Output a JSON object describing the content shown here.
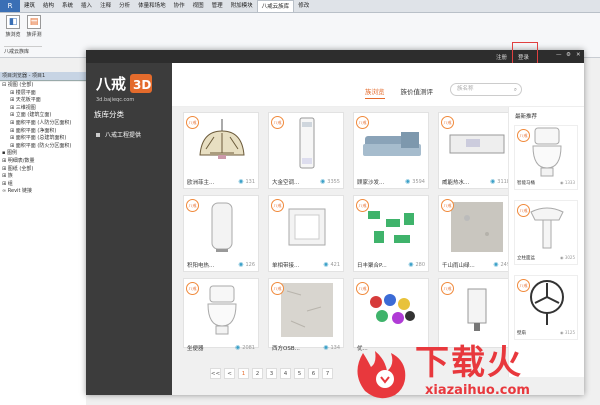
{
  "ribbon": {
    "tabs": [
      "建筑",
      "结构",
      "系统",
      "插入",
      "注释",
      "分析",
      "体量和场地",
      "协作",
      "视图",
      "管理",
      "附加模块",
      "八戒云族库",
      "修改"
    ],
    "active_tab": "八戒云族库",
    "buttons": [
      {
        "label": "族浏览"
      },
      {
        "label": "族评测"
      }
    ],
    "panel_label": "八戒云族库"
  },
  "project_browser": {
    "title": "项目浏览器 - 项目1",
    "items": [
      "视图 (全部)",
      "楼层平面",
      "天花板平面",
      "三维视图",
      "立面 (建筑立面)",
      "面积平面 (人防分区面积)",
      "面积平面 (净面积)",
      "面积平面 (总建筑面积)",
      "面积平面 (防火分区面积)",
      "图例",
      "明细表/数量",
      "图纸 (全部)",
      "族",
      "组",
      "Revit 链接"
    ]
  },
  "window": {
    "register": "注册",
    "login": "登录",
    "controls": [
      "—",
      "⚙",
      "✕"
    ]
  },
  "logo": {
    "text": "八戒",
    "badge": "3D",
    "url": "3d.bajieqc.com"
  },
  "sidebar": {
    "heading": "族库分类",
    "items": [
      "八戒工程提供"
    ]
  },
  "tabs": [
    {
      "label": "族浏览",
      "active": true
    },
    {
      "label": "族价值测评",
      "active": false
    }
  ],
  "search": {
    "placeholder": "族名称"
  },
  "badge_label": "八戒",
  "cards": [
    {
      "name": "欧洲菲主...",
      "views": "131",
      "icon": "lamp"
    },
    {
      "name": "大金空调...",
      "views": "3355",
      "icon": "ac"
    },
    {
      "name": "顾家沙发...",
      "views": "3594",
      "icon": "sofa"
    },
    {
      "name": "威能热水...",
      "views": "3118",
      "icon": "heater"
    },
    {
      "name": "积阳电热...",
      "views": "126",
      "icon": "tank"
    },
    {
      "name": "单相带接...",
      "views": "421",
      "icon": "socket"
    },
    {
      "name": "日丰聚合P...",
      "views": "280",
      "icon": "pipes"
    },
    {
      "name": "千山雨山绿...",
      "views": "249",
      "icon": "tile"
    },
    {
      "name": "坐便器",
      "views": "2081",
      "icon": "toilet"
    },
    {
      "name": "西方OSB...",
      "views": "134",
      "icon": "board"
    },
    {
      "name": "优...",
      "views": "",
      "icon": "chips"
    },
    {
      "name": "",
      "views": "",
      "icon": "boiler"
    }
  ],
  "recommend": {
    "title": "最新推荐",
    "items": [
      {
        "name": "智能马桶",
        "views": "1333",
        "icon": "toilet"
      },
      {
        "name": "立柱面盆",
        "views": "3025",
        "icon": "basin"
      },
      {
        "name": "壁扇",
        "views": "3125",
        "icon": "fan"
      }
    ]
  },
  "pager": [
    "<<",
    "<",
    "1",
    "2",
    "3",
    "4",
    "5",
    "6",
    "7"
  ],
  "pager_active": "1",
  "watermark": {
    "text": "下载火",
    "url": "xiazaihuo.com"
  }
}
